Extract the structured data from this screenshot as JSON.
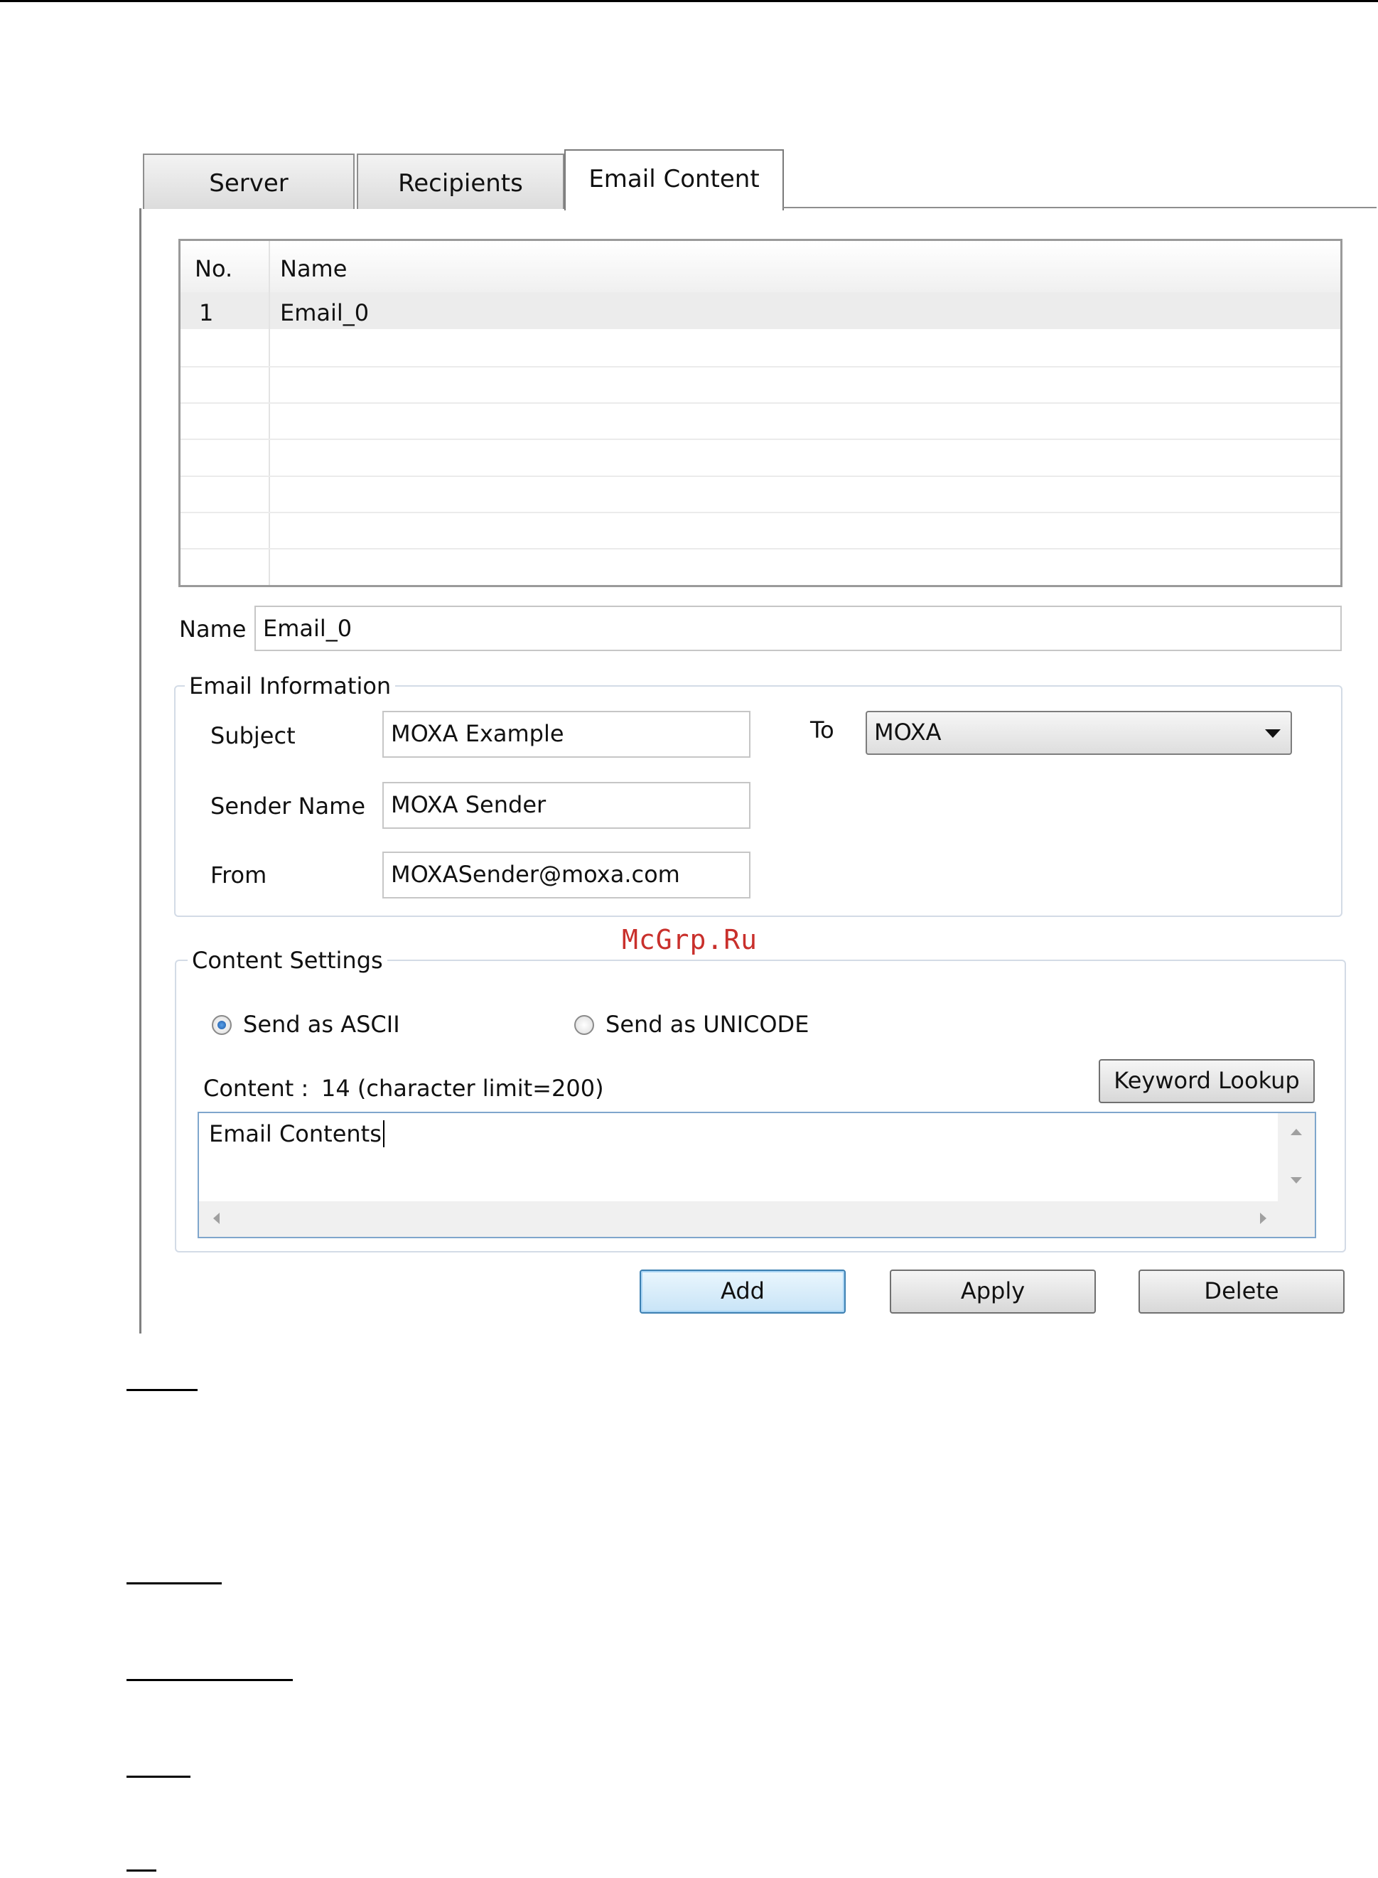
{
  "tabs": [
    {
      "label": "Server",
      "active": false
    },
    {
      "label": "Recipients",
      "active": false
    },
    {
      "label": "Email Content",
      "active": true
    }
  ],
  "table": {
    "columns": [
      "No.",
      "Name"
    ],
    "rows": [
      {
        "no": "1",
        "name": "Email_0"
      }
    ]
  },
  "name_field": {
    "label": "Name",
    "value": "Email_0"
  },
  "email_info": {
    "title": "Email Information",
    "subject_label": "Subject",
    "subject_value": "MOXA Example",
    "sender_label": "Sender Name",
    "sender_value": "MOXA Sender",
    "from_label": "From",
    "from_value": "MOXASender@moxa.com",
    "to_label": "To",
    "to_value": "MOXA"
  },
  "content_settings": {
    "title": "Content Settings",
    "ascii_label": "Send as ASCII",
    "unicode_label": "Send as UNICODE",
    "selected": "ascii",
    "content_label": "Content :",
    "content_count": "14 (character limit=200)",
    "keyword_button": "Keyword Lookup",
    "content_text": "Email Contents"
  },
  "buttons": {
    "add": "Add",
    "apply": "Apply",
    "delete": "Delete"
  },
  "watermark": "McGrp.Ru",
  "colors": {
    "tab_border": "#8e8e8e",
    "group_border": "#d3dbe6",
    "default_button": "#3c7fb1",
    "watermark": "#c9302c"
  }
}
